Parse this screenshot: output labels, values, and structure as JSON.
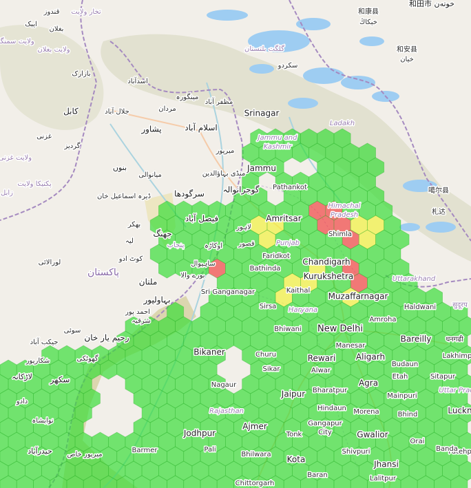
{
  "map": {
    "colors": {
      "land": "#f2efe9",
      "mountain": "#dcdcc7",
      "desert": "#efe3b3",
      "lake": "#9ecdf2",
      "border": "#a58ac0",
      "river": "#aad3df",
      "road": "#f6c39a",
      "hex_green": "#33dd33",
      "hex_yellow": "#f2f23a",
      "hex_red": "#f04040",
      "hex_stroke": "#1fa81f"
    },
    "labels": [
      {
        "id": "kunduz",
        "text": "قندوز",
        "size": 10,
        "color": "#333"
      },
      {
        "id": "takhar",
        "text": "تخار ولایت",
        "size": 10,
        "color": "#9a7fb0"
      },
      {
        "id": "aibak",
        "text": "ایبک",
        "size": 10,
        "color": "#333"
      },
      {
        "id": "baghlan",
        "text": "بغلان",
        "size": 10,
        "color": "#333"
      },
      {
        "id": "samangan",
        "text": "ولایت سمنگان",
        "size": 10,
        "color": "#9a7fb0"
      },
      {
        "id": "baghlan-prov",
        "text": "ولایت بغلان",
        "size": 10,
        "color": "#9a7fb0"
      },
      {
        "id": "bazarak",
        "text": "بازارک",
        "size": 10,
        "color": "#333"
      },
      {
        "id": "asadabad",
        "text": "اسدآباد",
        "size": 10,
        "color": "#333"
      },
      {
        "id": "mingora",
        "text": "مینگورہ",
        "size": 10,
        "color": "#333"
      },
      {
        "id": "mardan",
        "text": "مردان",
        "size": 10,
        "color": "#333"
      },
      {
        "id": "muzaffarabad",
        "text": "مظفر آباد",
        "size": 10,
        "color": "#333"
      },
      {
        "id": "kabul",
        "text": "کابل",
        "size": 12,
        "color": "#222"
      },
      {
        "id": "jalalabad",
        "text": "جلال آباد",
        "size": 10,
        "color": "#333"
      },
      {
        "id": "peshawar",
        "text": "پشاور",
        "size": 12,
        "color": "#222"
      },
      {
        "id": "islamabad",
        "text": "اسلام آباد",
        "size": 12,
        "color": "#222"
      },
      {
        "id": "ghazni",
        "text": "غزنی",
        "size": 10,
        "color": "#333"
      },
      {
        "id": "gardez",
        "text": "گردیز",
        "size": 10,
        "color": "#333"
      },
      {
        "id": "ghazni-prov",
        "text": "ولایت غزنی",
        "size": 10,
        "color": "#9a7fb0"
      },
      {
        "id": "mirpur",
        "text": "میرپور",
        "size": 10,
        "color": "#333"
      },
      {
        "id": "bannu",
        "text": "بنوں",
        "size": 11,
        "color": "#222"
      },
      {
        "id": "paktika",
        "text": "پکتیکا ولایت",
        "size": 10,
        "color": "#9a7fb0"
      },
      {
        "id": "zabul",
        "text": "زابل",
        "size": 10,
        "color": "#9a7fb0"
      },
      {
        "id": "mianwali",
        "text": "میانوالی",
        "size": 10,
        "color": "#333"
      },
      {
        "id": "sargodha",
        "text": "سرگودھا",
        "size": 12,
        "color": "#222"
      },
      {
        "id": "gujranwala",
        "text": "گوجرانوالہ",
        "size": 12,
        "color": "#222"
      },
      {
        "id": "mandi-bahauddin",
        "text": "منڈی بہاؤالدین",
        "size": 10,
        "color": "#333"
      },
      {
        "id": "dera-ismail-khan",
        "text": "ڈیرہ اسماعیل خان",
        "size": 10,
        "color": "#333"
      },
      {
        "id": "faisalabad",
        "text": "فیصل آباد",
        "size": 12,
        "color": "#222"
      },
      {
        "id": "lahore",
        "text": "لاہور",
        "size": 10,
        "color": "#333"
      },
      {
        "id": "bhakkar",
        "text": "بھکر",
        "size": 10,
        "color": "#333"
      },
      {
        "id": "jhang",
        "text": "جھنگ",
        "size": 12,
        "color": "#222"
      },
      {
        "id": "layyah",
        "text": "لیہ",
        "size": 10,
        "color": "#333"
      },
      {
        "id": "okara",
        "text": "اوکاڑہ",
        "size": 10,
        "color": "#333"
      },
      {
        "id": "kasur",
        "text": "قصور",
        "size": 10,
        "color": "#333"
      },
      {
        "id": "punjab-pk",
        "text": "پنجاب",
        "size": 10,
        "color": "#9a7fb0"
      },
      {
        "id": "kot-addu",
        "text": "کوٹ ادو",
        "size": 10,
        "color": "#333"
      },
      {
        "id": "loralai",
        "text": "لورالائی",
        "size": 10,
        "color": "#333"
      },
      {
        "id": "sahiwal",
        "text": "ساہیوال",
        "size": 10,
        "color": "#333"
      },
      {
        "id": "pakistan",
        "text": "پاکستان",
        "size": 14,
        "color": "#8a6aa8"
      },
      {
        "id": "multan",
        "text": "ملتان",
        "size": 12,
        "color": "#222"
      },
      {
        "id": "burewala",
        "text": "بورے والا",
        "size": 10,
        "color": "#333"
      },
      {
        "id": "bahawalpur",
        "text": "بہاولپور",
        "size": 12,
        "color": "#222"
      },
      {
        "id": "ahmadpur",
        "text": "احمد پور",
        "size": 10,
        "color": "#333"
      },
      {
        "id": "sharqia",
        "text": "شرقیہ",
        "size": 10,
        "color": "#333"
      },
      {
        "id": "sui",
        "text": "سوئی",
        "size": 10,
        "color": "#333"
      },
      {
        "id": "rahim-yar-khan",
        "text": "رحیم یار خان",
        "size": 12,
        "color": "#222"
      },
      {
        "id": "jacobabad",
        "text": "جیکب آباد",
        "size": 10,
        "color": "#333"
      },
      {
        "id": "shikarpur",
        "text": "شکارپور",
        "size": 10,
        "color": "#333"
      },
      {
        "id": "ghotki",
        "text": "گھوٹکی",
        "size": 10,
        "color": "#333"
      },
      {
        "id": "larkana",
        "text": "لاڑکانہ",
        "size": 11,
        "color": "#222"
      },
      {
        "id": "sukkur",
        "text": "سکھر",
        "size": 12,
        "color": "#222"
      },
      {
        "id": "dadu",
        "text": "دادو",
        "size": 10,
        "color": "#333"
      },
      {
        "id": "nawabshah",
        "text": "نوابشاہ",
        "size": 10,
        "color": "#333"
      },
      {
        "id": "hyderabad-pk",
        "text": "حیدرآباد",
        "size": 11,
        "color": "#222"
      },
      {
        "id": "mirpur-khas",
        "text": "میرپور خاص",
        "size": 10,
        "color": "#333"
      },
      {
        "id": "gilgit",
        "text": "گلگت بلتستان",
        "size": 10,
        "color": "#9a7fb0"
      },
      {
        "id": "skardu",
        "text": "سکردو",
        "size": 10,
        "color": "#333"
      },
      {
        "id": "hotan",
        "text": "和田市 خوتەن",
        "size": 11,
        "color": "#222"
      },
      {
        "id": "hekang",
        "text": "和康县",
        "size": 10,
        "color": "#333"
      },
      {
        "id": "hekang-ug",
        "text": "خېكاڭ",
        "size": 10,
        "color": "#333"
      },
      {
        "id": "hean",
        "text": "和安县",
        "size": 10,
        "color": "#333"
      },
      {
        "id": "hean-ug",
        "text": "خيان",
        "size": 10,
        "color": "#333"
      },
      {
        "id": "srinagar",
        "text": "Srinagar",
        "size": 12,
        "color": "#222"
      },
      {
        "id": "ladakh",
        "text": "Ladakh",
        "size": 10,
        "color": "#9a7fb0",
        "italic": true
      },
      {
        "id": "jk",
        "text": "Jammu and Kashmir",
        "size": 10,
        "color": "#9a7fb0",
        "italic": true
      },
      {
        "id": "jammu",
        "text": "Jammu",
        "size": 12,
        "color": "#222"
      },
      {
        "id": "pathankot",
        "text": "Pathankot",
        "size": 10,
        "color": "#333"
      },
      {
        "id": "gar",
        "text": "噶尔县",
        "size": 10,
        "color": "#333"
      },
      {
        "id": "zada",
        "text": "札达",
        "size": 10,
        "color": "#333"
      },
      {
        "id": "hp",
        "text": "Himachal Pradesh",
        "size": 10,
        "color": "#9a7fb0",
        "italic": true
      },
      {
        "id": "amritsar",
        "text": "Amritsar",
        "size": 12,
        "color": "#222"
      },
      {
        "id": "shimla",
        "text": "Shimla",
        "size": 10,
        "color": "#333"
      },
      {
        "id": "punjab-in",
        "text": "Punjab",
        "size": 10,
        "color": "#9a7fb0",
        "italic": true
      },
      {
        "id": "faridkot",
        "text": "Faridkot",
        "size": 10,
        "color": "#333"
      },
      {
        "id": "chandigarh",
        "text": "Chandigarh",
        "size": 12,
        "color": "#222"
      },
      {
        "id": "bathinda",
        "text": "Bathinda",
        "size": 10,
        "color": "#333"
      },
      {
        "id": "kurukshetra",
        "text": "Kurukshetra",
        "size": 12,
        "color": "#222"
      },
      {
        "id": "uttarakhand",
        "text": "Uttarakhand",
        "size": 10,
        "color": "#9a7fb0",
        "italic": true
      },
      {
        "id": "sri-ganganagar",
        "text": "Sri Ganganagar",
        "size": 10,
        "color": "#333"
      },
      {
        "id": "kaithal",
        "text": "Kaithal",
        "size": 10,
        "color": "#333"
      },
      {
        "id": "muzaffarnagar",
        "text": "Muzaffarnagar",
        "size": 12,
        "color": "#222"
      },
      {
        "id": "sirsa",
        "text": "Sirsa",
        "size": 10,
        "color": "#333"
      },
      {
        "id": "haryana",
        "text": "Haryana",
        "size": 10,
        "color": "#9a7fb0",
        "italic": true
      },
      {
        "id": "haldwani",
        "text": "Haldwani",
        "size": 10,
        "color": "#333"
      },
      {
        "id": "nepal",
        "text": "सुदूरप",
        "size": 10,
        "color": "#9a7fb0"
      },
      {
        "id": "bhiwani",
        "text": "Bhiwani",
        "size": 10,
        "color": "#333"
      },
      {
        "id": "new-delhi",
        "text": "New Delhi",
        "size": 13,
        "color": "#222"
      },
      {
        "id": "amroha",
        "text": "Amroha",
        "size": 10,
        "color": "#333"
      },
      {
        "id": "bareilly",
        "text": "Bareilly",
        "size": 12,
        "color": "#222"
      },
      {
        "id": "dhangadhi",
        "text": "धनगढी",
        "size": 10,
        "color": "#333"
      },
      {
        "id": "manesar",
        "text": "Manesar",
        "size": 10,
        "color": "#333"
      },
      {
        "id": "bikaner",
        "text": "Bikaner",
        "size": 12,
        "color": "#222"
      },
      {
        "id": "churu",
        "text": "Churu",
        "size": 10,
        "color": "#333"
      },
      {
        "id": "rewari",
        "text": "Rewari",
        "size": 12,
        "color": "#222"
      },
      {
        "id": "aligarh",
        "text": "Aligarh",
        "size": 12,
        "color": "#222"
      },
      {
        "id": "lakhimpur",
        "text": "Lakhimp",
        "size": 10,
        "color": "#333"
      },
      {
        "id": "budaun",
        "text": "Budaun",
        "size": 10,
        "color": "#333"
      },
      {
        "id": "sikar",
        "text": "Sikar",
        "size": 10,
        "color": "#333"
      },
      {
        "id": "alwar",
        "text": "Alwar",
        "size": 10,
        "color": "#333"
      },
      {
        "id": "etah",
        "text": "Etah",
        "size": 10,
        "color": "#333"
      },
      {
        "id": "sitapur",
        "text": "Sitapur",
        "size": 10,
        "color": "#333"
      },
      {
        "id": "nagaur",
        "text": "Nagaur",
        "size": 10,
        "color": "#333"
      },
      {
        "id": "agra",
        "text": "Agra",
        "size": 12,
        "color": "#222"
      },
      {
        "id": "up",
        "text": "Uttar Prad",
        "size": 10,
        "color": "#9a7fb0",
        "italic": true
      },
      {
        "id": "bharatpur",
        "text": "Bharatpur",
        "size": 10,
        "color": "#333"
      },
      {
        "id": "jaipur",
        "text": "Jaipur",
        "size": 12,
        "color": "#222"
      },
      {
        "id": "mainpuri",
        "text": "Mainpuri",
        "size": 10,
        "color": "#333"
      },
      {
        "id": "hindaun",
        "text": "Hindaun",
        "size": 10,
        "color": "#333"
      },
      {
        "id": "rajasthan",
        "text": "Rajasthan",
        "size": 10,
        "color": "#9a7fb0",
        "italic": true
      },
      {
        "id": "morena",
        "text": "Morena",
        "size": 10,
        "color": "#333"
      },
      {
        "id": "bhind",
        "text": "Bhind",
        "size": 10,
        "color": "#333"
      },
      {
        "id": "lucknow",
        "text": "Luckn",
        "size": 12,
        "color": "#222"
      },
      {
        "id": "gangapur",
        "text": "Gangapur",
        "size": 10,
        "color": "#333"
      },
      {
        "id": "gangapur2",
        "text": "City",
        "size": 10,
        "color": "#333"
      },
      {
        "id": "ajmer",
        "text": "Ajmer",
        "size": 12,
        "color": "#222"
      },
      {
        "id": "tonk",
        "text": "Tonk",
        "size": 10,
        "color": "#333"
      },
      {
        "id": "jodhpur",
        "text": "Jodhpur",
        "size": 12,
        "color": "#222"
      },
      {
        "id": "gwalior",
        "text": "Gwalior",
        "size": 12,
        "color": "#222"
      },
      {
        "id": "orai",
        "text": "Orai",
        "size": 10,
        "color": "#333"
      },
      {
        "id": "fatehpur",
        "text": "Fatehp",
        "size": 10,
        "color": "#333"
      },
      {
        "id": "barmer",
        "text": "Barmer",
        "size": 10,
        "color": "#333"
      },
      {
        "id": "pali",
        "text": "Pali",
        "size": 10,
        "color": "#333"
      },
      {
        "id": "shivpuri",
        "text": "Shivpuri",
        "size": 10,
        "color": "#333"
      },
      {
        "id": "banda",
        "text": "Banda",
        "size": 10,
        "color": "#333"
      },
      {
        "id": "bhilwara",
        "text": "Bhilwara",
        "size": 10,
        "color": "#333"
      },
      {
        "id": "kota",
        "text": "Kota",
        "size": 12,
        "color": "#222"
      },
      {
        "id": "jhansi",
        "text": "Jhansi",
        "size": 12,
        "color": "#222"
      },
      {
        "id": "baran",
        "text": "Baran",
        "size": 10,
        "color": "#333"
      },
      {
        "id": "lalitpur",
        "text": "Lalitpur",
        "size": 10,
        "color": "#333"
      },
      {
        "id": "chittorgarh",
        "text": "Chittorgarh",
        "size": 10,
        "color": "#333"
      }
    ]
  }
}
